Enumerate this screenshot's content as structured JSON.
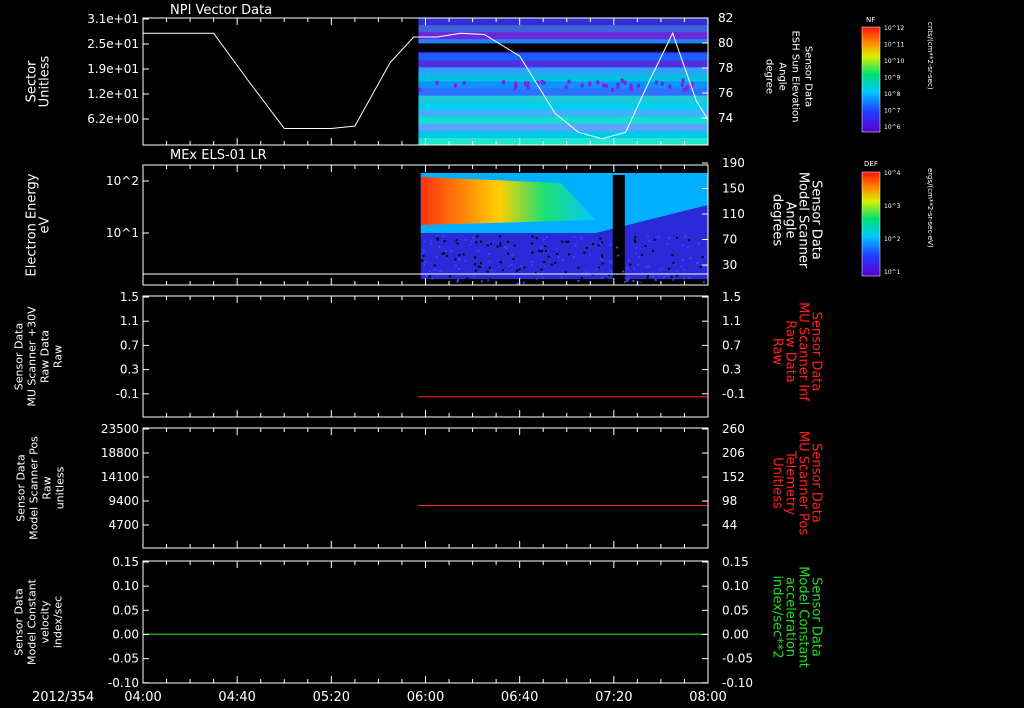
{
  "date_label": "2012/354",
  "x_ticks": [
    "04:00",
    "04:40",
    "05:20",
    "06:00",
    "06:40",
    "07:20",
    "08:00"
  ],
  "colors": {
    "white": "#ffffff",
    "red": "#ff2020",
    "green": "#22dd22"
  },
  "colorbars": [
    {
      "title": "NF",
      "unit": "cnts/(cm**2-sr-sec)",
      "ticks": [
        "10^12",
        "10^11",
        "10^10",
        "10^9",
        "10^8",
        "10^7",
        "10^6"
      ]
    },
    {
      "title": "DEF",
      "unit": "ergs/(cm**2-sr-sec-eV)",
      "ticks": [
        "10^4",
        "10^3",
        "10^2",
        "10^1"
      ]
    }
  ],
  "chart_data": [
    {
      "type": "heatmap",
      "title": "NPI Vector Data",
      "ylabel": [
        "Sector",
        "Unitless"
      ],
      "yticks": [
        "3.1e+01",
        "2.5e+01",
        "1.9e+01",
        "1.2e+01",
        "6.2e+00"
      ],
      "ylabel_right": [
        "Sensor Data",
        "ESH Sun Elevation",
        "Angle",
        "degree"
      ],
      "yticks_right": [
        "82",
        "80",
        "78",
        "76",
        "74"
      ],
      "right_ylim": [
        72,
        82
      ],
      "data_start": "05:57",
      "overlay_line": {
        "name": "ESH Sun Elevation Angle",
        "x": [
          "04:00",
          "04:30",
          "04:45",
          "05:00",
          "05:20",
          "05:30",
          "05:45",
          "05:55",
          "06:05",
          "06:15",
          "06:25",
          "06:40",
          "06:55",
          "07:05",
          "07:15",
          "07:25",
          "07:35",
          "07:45",
          "07:55",
          "08:00"
        ],
        "y": [
          80.8,
          80.8,
          77.0,
          73.3,
          73.3,
          73.5,
          78.5,
          80.5,
          80.5,
          80.8,
          80.7,
          79.0,
          74.5,
          73.0,
          72.5,
          73.0,
          77.0,
          80.8,
          75.5,
          74.0
        ]
      }
    },
    {
      "type": "heatmap",
      "title": "MEx ELS-01 LR",
      "ylabel": [
        "Electron Energy",
        "eV"
      ],
      "yticks": [
        "10^2",
        "10^1"
      ],
      "ylabel_right": [
        "Sensor Data",
        "Model Scanner",
        "Angle",
        "degrees"
      ],
      "yticks_right": [
        "190",
        "150",
        "110",
        "70",
        "30"
      ],
      "data_start": "05:58"
    },
    {
      "type": "line",
      "ylabel": [
        "Sensor Data",
        "MU Scanner +30V",
        "Raw Data",
        "Raw"
      ],
      "yticks": [
        "1.5",
        "1.1",
        "0.7",
        "0.3",
        "-0.1"
      ],
      "ylim": [
        -0.3,
        1.5
      ],
      "ylabel_right": [
        "Sensor Data",
        "MU Scanner Inf",
        "Raw Data",
        "Raw"
      ],
      "yticks_right": [
        "1.5",
        "1.1",
        "0.7",
        "0.3",
        "-0.1"
      ],
      "series": [
        {
          "x": [
            "05:57",
            "08:00"
          ],
          "y": [
            0.0,
            0.0
          ]
        }
      ]
    },
    {
      "type": "line",
      "ylabel": [
        "Sensor Data",
        "Model Scanner Pos",
        "Raw",
        "unitless"
      ],
      "yticks": [
        "23500",
        "18800",
        "14100",
        "9400",
        "4700"
      ],
      "ylabel_right": [
        "Sensor Data",
        "MU Scanner Pos",
        "Telemetry",
        "Unitless"
      ],
      "yticks_right": [
        "260",
        "206",
        "152",
        "98",
        "44"
      ],
      "right_ylim": [
        0,
        260
      ],
      "series": [
        {
          "x": [
            "05:57",
            "08:00"
          ],
          "y_right": [
            92,
            92
          ]
        }
      ]
    },
    {
      "type": "line",
      "ylabel": [
        "Sensor Data",
        "Model Constant",
        "velocity",
        "index/sec"
      ],
      "yticks": [
        "0.15",
        "0.10",
        "0.05",
        "0.00",
        "-0.05",
        "-0.10"
      ],
      "ylim": [
        -0.1,
        0.15
      ],
      "ylabel_right": [
        "Sensor Data",
        "Model Constant",
        "acceleration",
        "index/sec**2"
      ],
      "yticks_right": [
        "0.15",
        "0.10",
        "0.05",
        "0.00",
        "-0.05",
        "-0.10"
      ],
      "series": [
        {
          "x": [
            "04:00",
            "08:00"
          ],
          "y": [
            0.0,
            0.0
          ]
        }
      ]
    }
  ]
}
